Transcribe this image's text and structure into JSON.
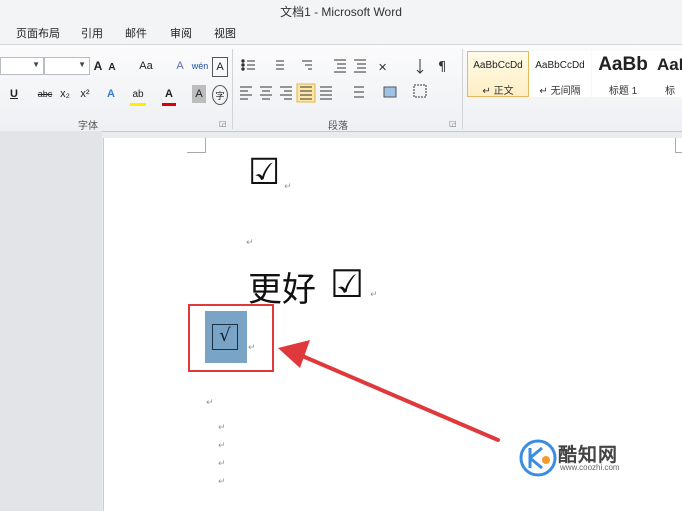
{
  "window": {
    "title": "文档1 - Microsoft Word"
  },
  "tabs": [
    "页面布局",
    "引用",
    "邮件",
    "审阅",
    "视图"
  ],
  "ribbon": {
    "font_group_label": "字体",
    "paragraph_group_label": "段落",
    "font_buttons": {
      "grow": "A",
      "shrink": "A",
      "change_case": "Aa",
      "clear_format": "A",
      "phonetic": "wén",
      "char_border": "A",
      "underline": "U",
      "strike": "abc",
      "subscript": "x₂",
      "superscript": "x²",
      "text_effect": "A",
      "highlight": "ab",
      "font_color": "A",
      "char_shading": "A",
      "enclose": "字"
    },
    "styles": [
      {
        "preview": "AaBbCcDd",
        "name": "↵ 正文",
        "selected": true
      },
      {
        "preview": "AaBbCcDd",
        "name": "↵ 无间隔",
        "selected": false
      },
      {
        "preview": "AaBb",
        "name": "标题 1",
        "selected": false
      },
      {
        "preview": "AaI",
        "name": "标题",
        "selected": false
      }
    ]
  },
  "document": {
    "checkbox_line_1": "☑",
    "text_line": "更好",
    "checkbox_line_2": "☑",
    "selected_symbol": "√",
    "paragraph_mark": "↵"
  },
  "watermark": {
    "text": "酷知网",
    "url": "www.coozhi.com"
  },
  "colors": {
    "annotation_red": "#e0393b",
    "selection_blue": "#7aa4c6"
  }
}
